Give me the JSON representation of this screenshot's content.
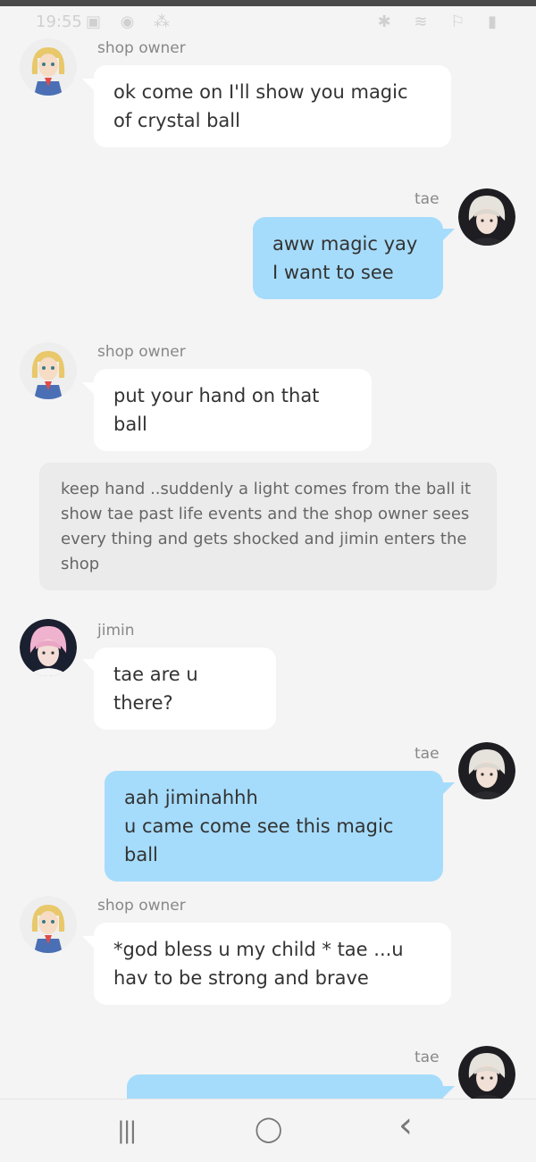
{
  "status": {
    "time": "19:55",
    "left_icons": "▣ ◉ ⁂",
    "right_icons": "✱ ≋ ⚐ ▮"
  },
  "messages": [
    {
      "name": "shop owner",
      "text": "ok come on I'll show you magic of crystal ball"
    },
    {
      "name": "tae",
      "text": "aww magic yay\nI want to see"
    },
    {
      "name": "shop owner",
      "text": "put your hand on that ball"
    },
    {
      "text": "keep hand ..suddenly a light comes from the ball it show tae past life events and the shop owner sees every thing and gets shocked and jimin enters the shop"
    },
    {
      "name": "jimin",
      "text": "tae are u there?"
    },
    {
      "name": "tae",
      "text": "aah jiminahhh\nu came come see this magic ball"
    },
    {
      "name": "shop owner",
      "text": "*god bless u my child * tae ...u hav to be strong and brave"
    },
    {
      "name": "tae",
      "text": ""
    }
  ],
  "nav": {
    "recents": "|||",
    "home": "◯",
    "back": "‹"
  },
  "colors": {
    "right_bubble": "#a6dcfb",
    "left_bubble": "#ffffff",
    "narration": "#ebebeb",
    "background": "#f4f4f4"
  }
}
